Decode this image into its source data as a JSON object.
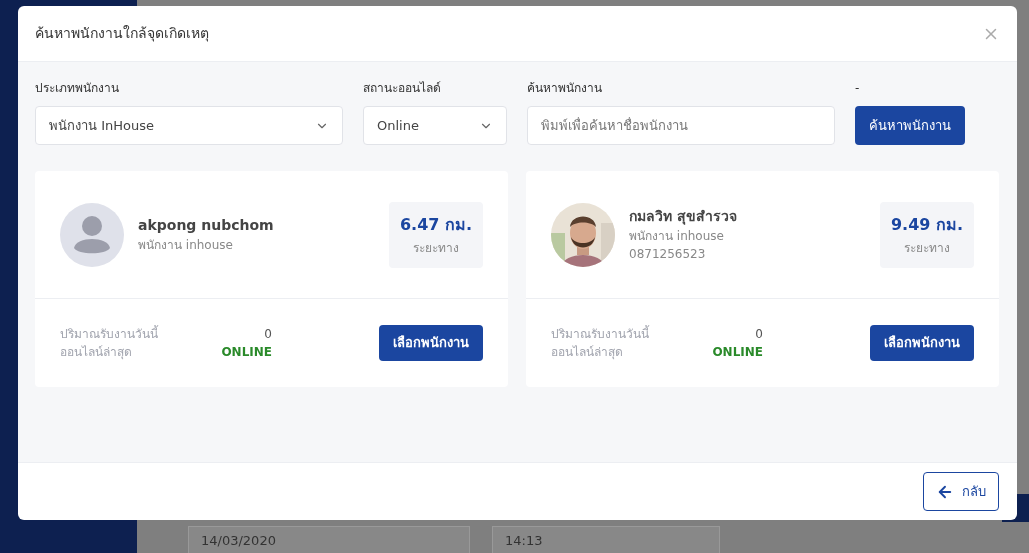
{
  "background": {
    "date": "14/03/2020",
    "time": "14:13"
  },
  "modal": {
    "title": "ค้นหาพนักงานใกล้จุดเกิดเหตุ",
    "filters": {
      "employee_type": {
        "label": "ประเภทพนักงาน",
        "value": "พนักงาน InHouse"
      },
      "online_status": {
        "label": "สถานะออนไลด์",
        "value": "Online"
      },
      "search": {
        "label": "ค้นหาพนักงาน",
        "placeholder": "พิมพ์เพื่อค้นหาชื่อพนักงาน"
      },
      "search_button": {
        "label": "-",
        "text": "ค้นหาพนักงาน"
      }
    },
    "employees": [
      {
        "avatar": {
          "kind": "placeholder"
        },
        "name": "akpong nubchom",
        "role": "พนักงาน inhouse",
        "distance": "6.47 กม.",
        "distance_label": "ระยะทาง",
        "jobs_label": "ปริมาณรับงานวันนี้",
        "jobs": "0",
        "last_online_label": "ออนไลน์ล่าสุด",
        "status": "ONLINE",
        "button": "เลือกพนักงาน"
      },
      {
        "name": "กมลวิท สุขสำรวจ",
        "role": "พนักงาน inhouse",
        "phone": "0871256523",
        "distance": "9.49 กม.",
        "distance_label": "ระยะทาง",
        "jobs_label": "ปริมาณรับงานวันนี้",
        "jobs": "0",
        "last_online_label": "ออนไลน์ล่าสุด",
        "status": "ONLINE",
        "button": "เลือกพนักงาน"
      }
    ],
    "back_button": "กลับ"
  }
}
